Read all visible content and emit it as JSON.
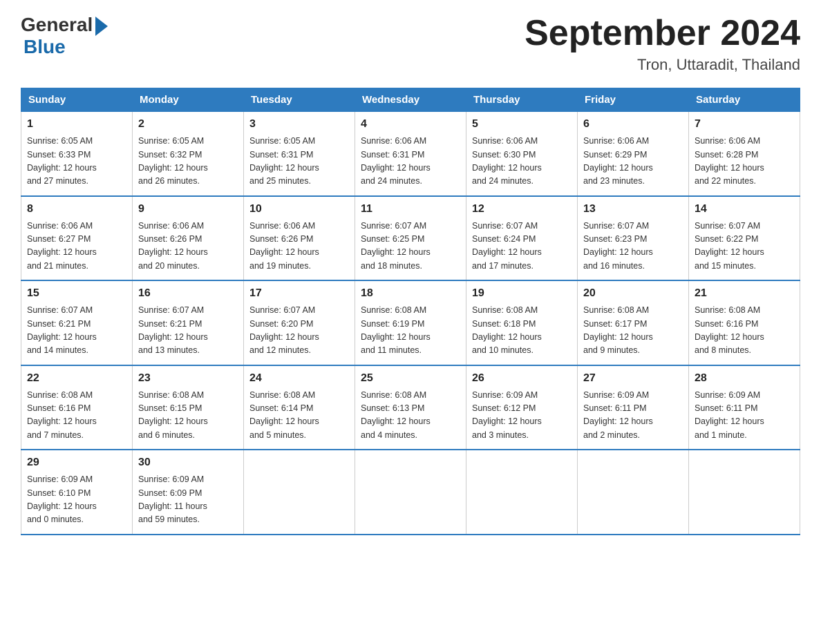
{
  "logo": {
    "general": "General",
    "blue": "Blue",
    "tagline": "Blue"
  },
  "header": {
    "month_year": "September 2024",
    "location": "Tron, Uttaradit, Thailand"
  },
  "weekdays": [
    "Sunday",
    "Monday",
    "Tuesday",
    "Wednesday",
    "Thursday",
    "Friday",
    "Saturday"
  ],
  "weeks": [
    [
      {
        "day": "1",
        "sunrise": "6:05 AM",
        "sunset": "6:33 PM",
        "daylight": "12 hours and 27 minutes."
      },
      {
        "day": "2",
        "sunrise": "6:05 AM",
        "sunset": "6:32 PM",
        "daylight": "12 hours and 26 minutes."
      },
      {
        "day": "3",
        "sunrise": "6:05 AM",
        "sunset": "6:31 PM",
        "daylight": "12 hours and 25 minutes."
      },
      {
        "day": "4",
        "sunrise": "6:06 AM",
        "sunset": "6:31 PM",
        "daylight": "12 hours and 24 minutes."
      },
      {
        "day": "5",
        "sunrise": "6:06 AM",
        "sunset": "6:30 PM",
        "daylight": "12 hours and 24 minutes."
      },
      {
        "day": "6",
        "sunrise": "6:06 AM",
        "sunset": "6:29 PM",
        "daylight": "12 hours and 23 minutes."
      },
      {
        "day": "7",
        "sunrise": "6:06 AM",
        "sunset": "6:28 PM",
        "daylight": "12 hours and 22 minutes."
      }
    ],
    [
      {
        "day": "8",
        "sunrise": "6:06 AM",
        "sunset": "6:27 PM",
        "daylight": "12 hours and 21 minutes."
      },
      {
        "day": "9",
        "sunrise": "6:06 AM",
        "sunset": "6:26 PM",
        "daylight": "12 hours and 20 minutes."
      },
      {
        "day": "10",
        "sunrise": "6:06 AM",
        "sunset": "6:26 PM",
        "daylight": "12 hours and 19 minutes."
      },
      {
        "day": "11",
        "sunrise": "6:07 AM",
        "sunset": "6:25 PM",
        "daylight": "12 hours and 18 minutes."
      },
      {
        "day": "12",
        "sunrise": "6:07 AM",
        "sunset": "6:24 PM",
        "daylight": "12 hours and 17 minutes."
      },
      {
        "day": "13",
        "sunrise": "6:07 AM",
        "sunset": "6:23 PM",
        "daylight": "12 hours and 16 minutes."
      },
      {
        "day": "14",
        "sunrise": "6:07 AM",
        "sunset": "6:22 PM",
        "daylight": "12 hours and 15 minutes."
      }
    ],
    [
      {
        "day": "15",
        "sunrise": "6:07 AM",
        "sunset": "6:21 PM",
        "daylight": "12 hours and 14 minutes."
      },
      {
        "day": "16",
        "sunrise": "6:07 AM",
        "sunset": "6:21 PM",
        "daylight": "12 hours and 13 minutes."
      },
      {
        "day": "17",
        "sunrise": "6:07 AM",
        "sunset": "6:20 PM",
        "daylight": "12 hours and 12 minutes."
      },
      {
        "day": "18",
        "sunrise": "6:08 AM",
        "sunset": "6:19 PM",
        "daylight": "12 hours and 11 minutes."
      },
      {
        "day": "19",
        "sunrise": "6:08 AM",
        "sunset": "6:18 PM",
        "daylight": "12 hours and 10 minutes."
      },
      {
        "day": "20",
        "sunrise": "6:08 AM",
        "sunset": "6:17 PM",
        "daylight": "12 hours and 9 minutes."
      },
      {
        "day": "21",
        "sunrise": "6:08 AM",
        "sunset": "6:16 PM",
        "daylight": "12 hours and 8 minutes."
      }
    ],
    [
      {
        "day": "22",
        "sunrise": "6:08 AM",
        "sunset": "6:16 PM",
        "daylight": "12 hours and 7 minutes."
      },
      {
        "day": "23",
        "sunrise": "6:08 AM",
        "sunset": "6:15 PM",
        "daylight": "12 hours and 6 minutes."
      },
      {
        "day": "24",
        "sunrise": "6:08 AM",
        "sunset": "6:14 PM",
        "daylight": "12 hours and 5 minutes."
      },
      {
        "day": "25",
        "sunrise": "6:08 AM",
        "sunset": "6:13 PM",
        "daylight": "12 hours and 4 minutes."
      },
      {
        "day": "26",
        "sunrise": "6:09 AM",
        "sunset": "6:12 PM",
        "daylight": "12 hours and 3 minutes."
      },
      {
        "day": "27",
        "sunrise": "6:09 AM",
        "sunset": "6:11 PM",
        "daylight": "12 hours and 2 minutes."
      },
      {
        "day": "28",
        "sunrise": "6:09 AM",
        "sunset": "6:11 PM",
        "daylight": "12 hours and 1 minute."
      }
    ],
    [
      {
        "day": "29",
        "sunrise": "6:09 AM",
        "sunset": "6:10 PM",
        "daylight": "12 hours and 0 minutes."
      },
      {
        "day": "30",
        "sunrise": "6:09 AM",
        "sunset": "6:09 PM",
        "daylight": "11 hours and 59 minutes."
      },
      null,
      null,
      null,
      null,
      null
    ]
  ]
}
